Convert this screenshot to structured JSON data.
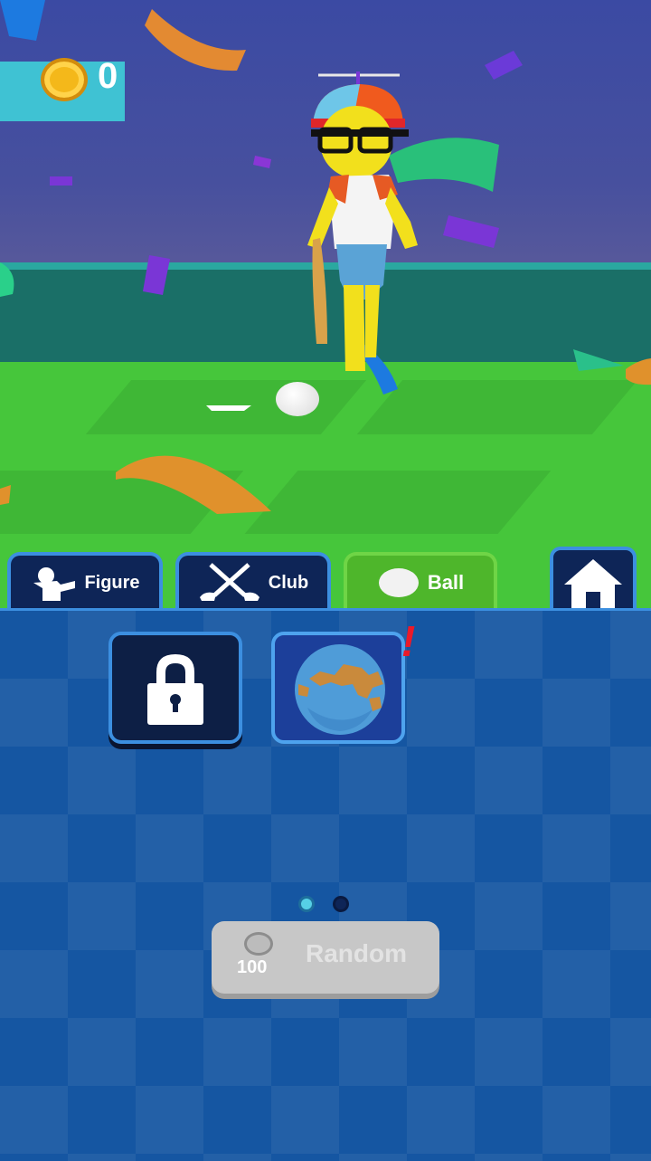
{
  "hud": {
    "coins": "0",
    "coin_icon": "gold-coin-icon"
  },
  "tabs": [
    {
      "label": "Figure",
      "icon": "figure-icon",
      "active": false
    },
    {
      "label": "Club",
      "icon": "club-icon",
      "active": false
    },
    {
      "label": "Ball",
      "icon": "ball-icon",
      "active": true
    }
  ],
  "home": {
    "icon": "home-icon"
  },
  "items": [
    {
      "state": "locked",
      "icon": "lock-icon"
    },
    {
      "state": "selected",
      "icon": "earth-ball-icon",
      "badge": "!"
    }
  ],
  "pager": {
    "current": 1,
    "total": 2
  },
  "random": {
    "label": "Random",
    "price": "100",
    "icon": "silver-coin-icon"
  },
  "colors": {
    "active_tab": "#4eb62b",
    "tab_dark": "#0e2557",
    "accent_border": "#3c8fe0",
    "panel": "#1556a2",
    "alert": "#ea1a2a"
  }
}
